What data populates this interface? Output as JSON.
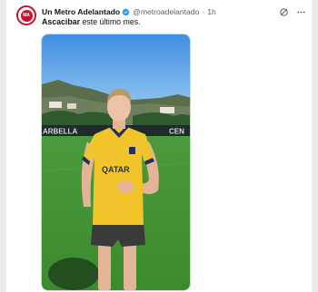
{
  "author": {
    "display_name": "Un Metro Adelantado",
    "handle": "@metroadelantado",
    "separator": "·",
    "time": "1h",
    "avatar_initials": "MA"
  },
  "tweet": {
    "text_bold": "Ascacibar",
    "text_rest": " este último mes."
  },
  "media": {
    "banner_left": "ARBELLA",
    "banner_right": "CEN",
    "shirt_sponsor": "QATAR"
  },
  "icons": {
    "verified": "verified-badge-icon",
    "grok": "grok-icon",
    "more": "more-icon"
  },
  "colors": {
    "accent": "#1d9bf0",
    "brand_red": "#c8102e",
    "kit_yellow": "#f2c42b",
    "kit_navy": "#1f2f6b"
  }
}
